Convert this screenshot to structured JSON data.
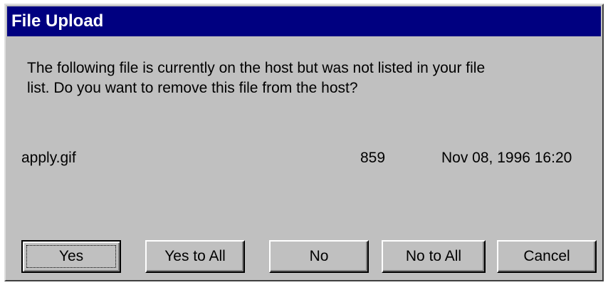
{
  "window": {
    "title": "File Upload"
  },
  "message": {
    "line1": "The following file is currently on the host but was not listed in your file",
    "line2": "list.  Do you want to remove this file from the host?"
  },
  "file": {
    "name": "apply.gif",
    "size": "859",
    "date": "Nov 08, 1996  16:20"
  },
  "buttons": {
    "yes": "Yes",
    "yes_to_all": "Yes to All",
    "no": "No",
    "no_to_all": "No to All",
    "cancel": "Cancel"
  },
  "colors": {
    "titlebar": "#000080",
    "face": "#c0c0c0",
    "text": "#000000"
  }
}
